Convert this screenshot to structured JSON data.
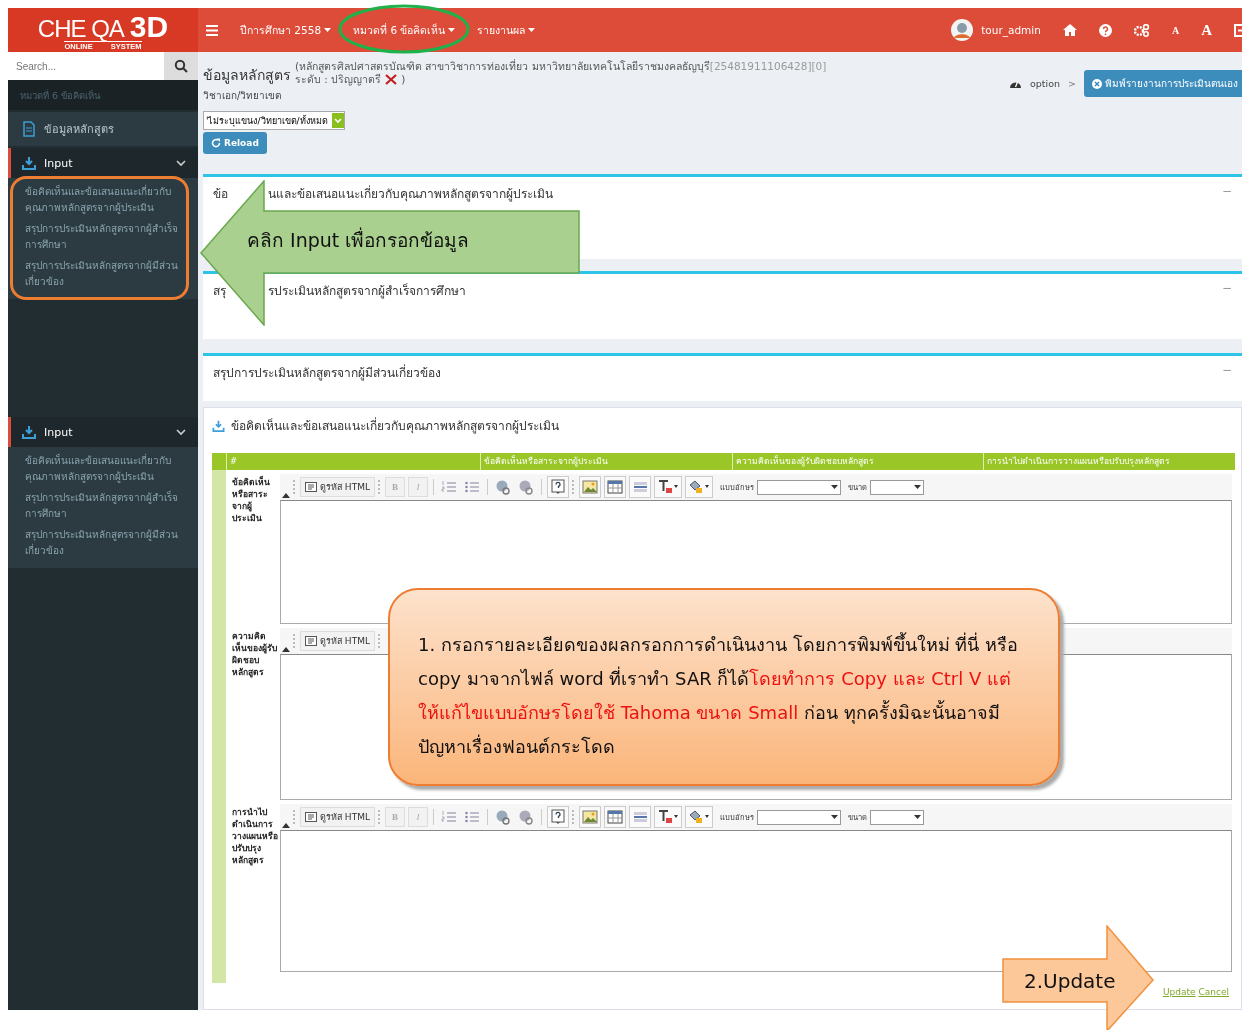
{
  "brand": {
    "name": "CHE QA",
    "mark": "3D",
    "tagline_left": "ONLINE",
    "tagline_right": "SYSTEM"
  },
  "topnav": {
    "menus": [
      {
        "label": "ปีการศึกษา 2558",
        "circled": false
      },
      {
        "label": "หมวดที่ 6 ข้อคิดเห็น",
        "circled": true
      },
      {
        "label": "รายงานผล",
        "circled": false
      }
    ],
    "user": "tour_admin",
    "font_small": "A",
    "font_large": "A"
  },
  "sidebar": {
    "search_placeholder": "Search...",
    "breadcrumb": "หมวดที่ 6 ข้อคิดเห็น",
    "top_item": "ข้อมูลหลักสูตร",
    "groups": [
      {
        "label": "Input",
        "expanded": true,
        "circled": true,
        "children": [
          {
            "label": "ข้อคิดเห็นและข้อเสนอแนะเกี่ยวกับคุณภาพหลักสูตรจากผู้ประเมิน"
          },
          {
            "label": "สรุปการประเมินหลักสูตรจากผู้สำเร็จการศึกษา"
          },
          {
            "label": "สรุปการประเมินหลักสูตรจากผู้มีส่วนเกี่ยวข้อง"
          }
        ]
      },
      {
        "label": "Input",
        "expanded": true,
        "circled": false,
        "children": [
          {
            "label": "ข้อคิดเห็นและข้อเสนอแนะเกี่ยวกับคุณภาพหลักสูตรจากผู้ประเมิน"
          },
          {
            "label": "สรุปการประเมินหลักสูตรจากผู้สำเร็จการศึกษา"
          },
          {
            "label": "สรุปการประเมินหลักสูตรจากผู้มีส่วนเกี่ยวข้อง"
          }
        ]
      }
    ]
  },
  "header": {
    "title": "ข้อมูลหลักสูตร",
    "program": "(หลักสูตรศิลปศาสตรบัณฑิต สาขาวิชาการท่องเที่ยว มหาวิทยาลัยเทคโนโลยีราชมงคลธัญบุรี",
    "program_code": "[25481911106428][0]",
    "level": "ระดับ : ปริญญาตรี",
    "close_paren": ")",
    "subtitle": "วิชาเอก/วิทยาเขต",
    "select_value": "'ไม่ระบุแขนง/วิทยาเขต/ทั้งหมด",
    "reload": "Reload",
    "option": "option",
    "separator": ">",
    "print": "พิมพ์รายงานการประเมินตนเอง"
  },
  "panels": [
    {
      "title_parts": [
        "ข้อ",
        "นและข้อเสนอแนะเกี่ยวกับคุณภาพหลักสูตรจากผู้ประเมิน"
      ],
      "collapse": "−"
    },
    {
      "title_parts": [
        "สรุ",
        "รประเมินหลักสูตรจากผู้สำเร็จการศึกษา"
      ],
      "collapse": "−"
    },
    {
      "title_parts": [
        "สรุปการประเมินหลักสูตรจากผู้มีส่วนเกี่ยวข้อง"
      ],
      "collapse": "−"
    }
  ],
  "form": {
    "title": "ข้อคิดเห็นและข้อเสนอแนะเกี่ยวกับคุณภาพหลักสูตรจากผู้ประเมิน",
    "columns": [
      "#",
      "ข้อคิดเห็นหรือสาระจากผู้ประเมิน",
      "ความคิดเห็นของผู้รับผิดชอบหลักสูตร",
      "การนำไปดำเนินการวางแผนหรือปรับปรุงหลักสูตร"
    ],
    "rows": [
      {
        "label": "ข้อคิดเห็นหรือสาระจากผู้ประเมิน",
        "toolbar": {
          "kind": "full",
          "source": "ดูรหัส HTML",
          "bold": "B",
          "italic": "I",
          "font_label": "แบบอักษร",
          "size_label": "ขนาด"
        }
      },
      {
        "label": "ความคิดเห็นของผู้รับผิดชอบหลักสูตร",
        "toolbar": {
          "kind": "partial",
          "source": "ดูรหัส HTML"
        }
      },
      {
        "label": "การนำไปดำเนินการวางแผนหรือปรับปรุงหลักสูตร",
        "toolbar": {
          "kind": "full",
          "source": "ดูรหัส HTML",
          "bold": "B",
          "italic": "I",
          "font_label": "แบบอักษร",
          "size_label": "ขนาด"
        }
      }
    ],
    "links": [
      "Update",
      "Cancel"
    ]
  },
  "annotations": {
    "arrow_left": "คลิก Input เพื่อกรอกข้อมูล",
    "note": [
      {
        "kind": "plain",
        "text": "1. กรอกรายละเอียดของผลกรอกการดำเนินงาน โดยการพิมพ์ขึ้นใหม่ ที่นี่ หรือ copy มาจากไฟล์ word ที่เราทำ SAR ก็ได้"
      },
      {
        "kind": "emphasis",
        "text": "โดยทำการ Copy และ Ctrl V แต่ให้แก้ไขแบบอักษรโดยใช้ Tahoma ขนาด Small"
      },
      {
        "kind": "plain",
        "text": " ก่อน ทุกครั้งมิฉะนั้นอาจมีปัญหาเรื่องฟอนต์กระโดด"
      }
    ],
    "arrow_right": "2.Update"
  }
}
